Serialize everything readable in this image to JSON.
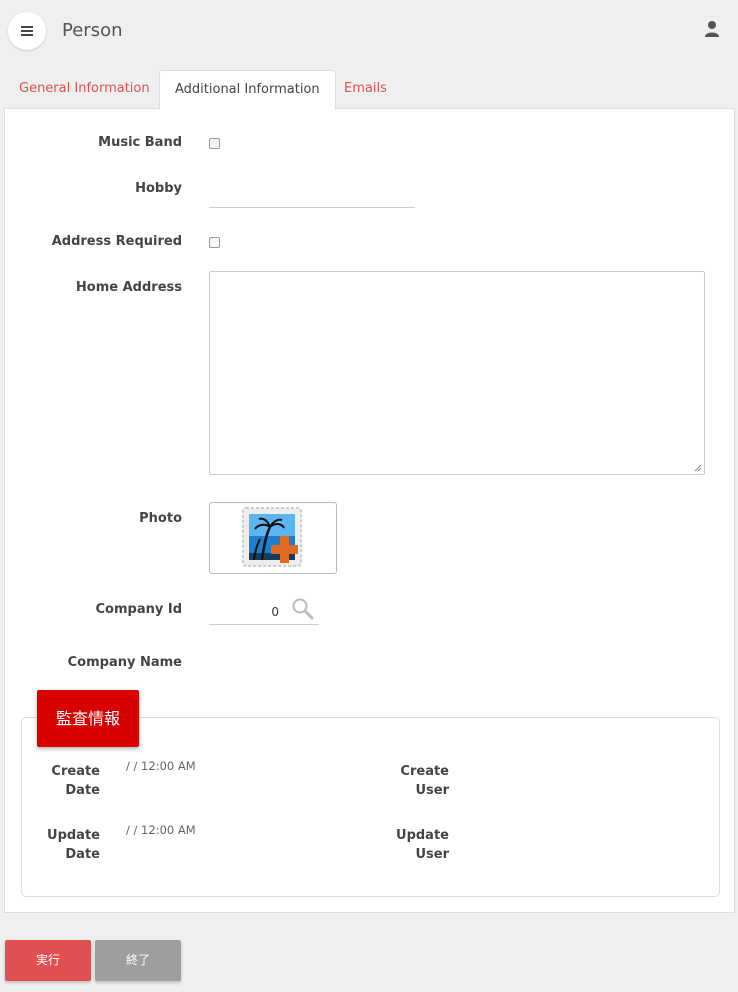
{
  "header": {
    "title": "Person",
    "menu_icon": "hamburger-icon",
    "user_icon": "user-icon"
  },
  "tabs": [
    {
      "label": "General Information",
      "active": false
    },
    {
      "label": "Additional Information",
      "active": true
    },
    {
      "label": "Emails",
      "active": false
    }
  ],
  "form": {
    "music_band_label": "Music Band",
    "music_band_checked": false,
    "hobby_label": "Hobby",
    "hobby_value": "",
    "address_required_label": "Address Required",
    "address_required_checked": false,
    "home_address_label": "Home Address",
    "home_address_value": "",
    "photo_label": "Photo",
    "company_id_label": "Company Id",
    "company_id_value": "0",
    "company_name_label": "Company Name",
    "company_name_value": ""
  },
  "audit": {
    "title": "監査情報",
    "create_date_label_1": "Create",
    "create_date_label_2": "Date",
    "create_date_value": "/ / 12:00 AM",
    "create_user_label_1": "Create",
    "create_user_label_2": "User",
    "update_date_label_1": "Update",
    "update_date_label_2": "Date",
    "update_date_value": "/ / 12:00 AM",
    "update_user_label_1": "Update",
    "update_user_label_2": "User"
  },
  "buttons": {
    "run": "実行",
    "end": "終了"
  },
  "colors": {
    "accent": "#d9534f",
    "audit_badge": "#d90000",
    "run_button": "#e05050",
    "end_button": "#9e9e9e"
  }
}
